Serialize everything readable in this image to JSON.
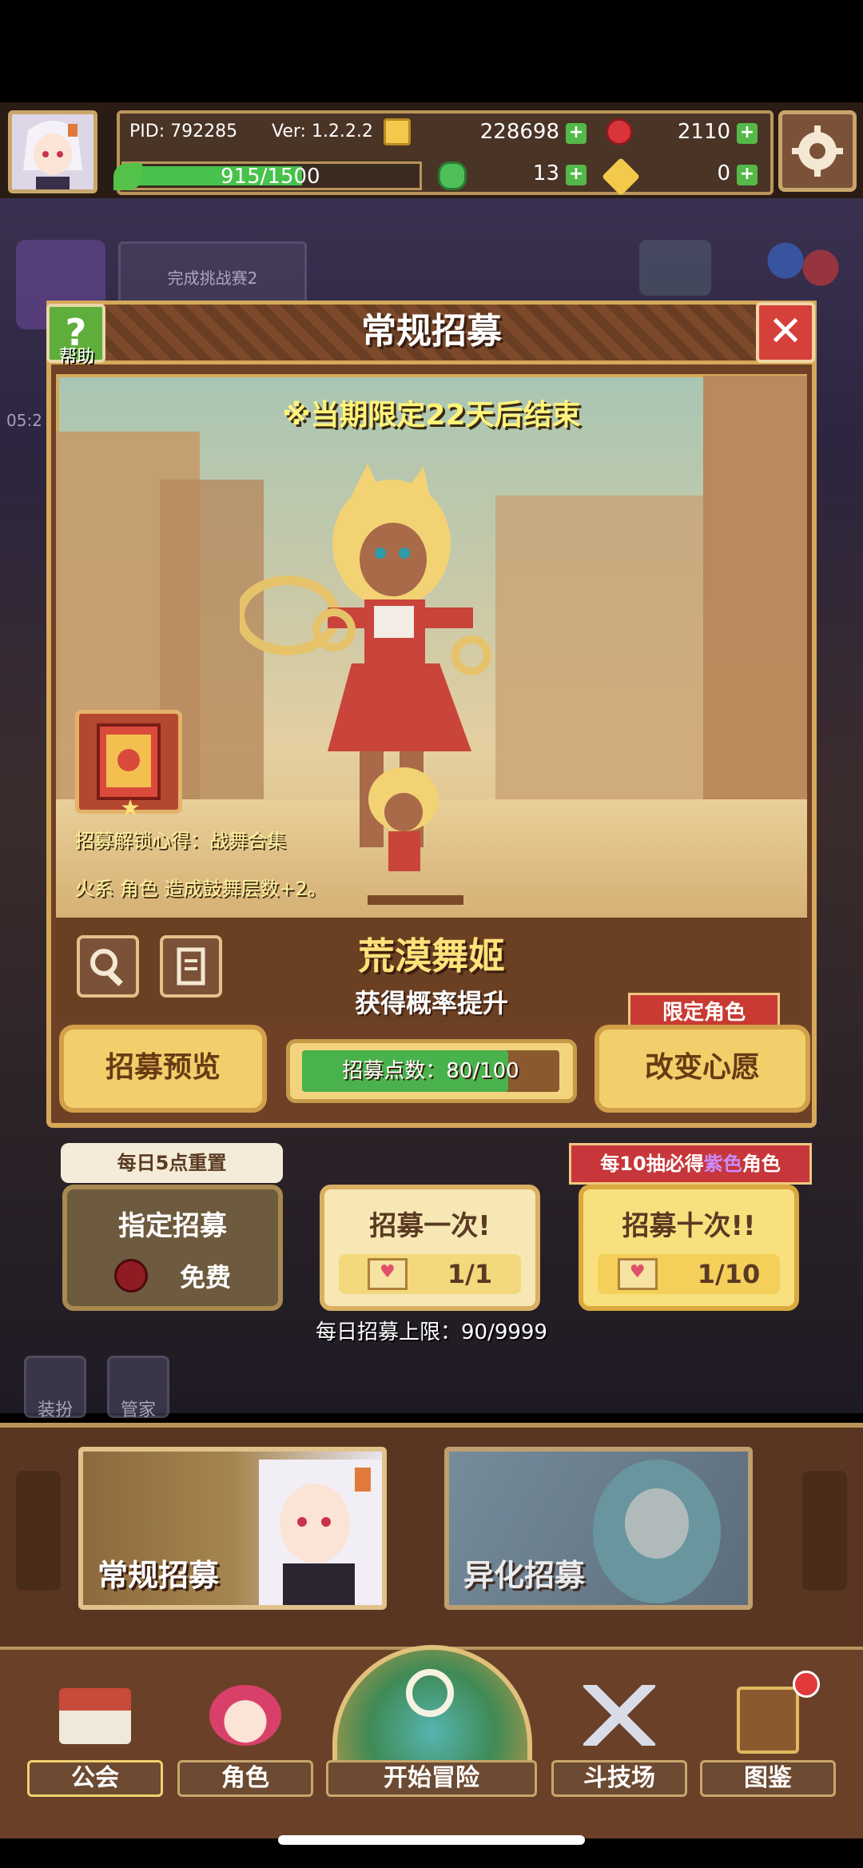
{
  "hud": {
    "pid": "PID: 792285",
    "version": "Ver: 1.2.2.2",
    "gold": "228698",
    "gems": "2110",
    "xp": "915/1500",
    "clover": "13",
    "keys": "0"
  },
  "background": {
    "challenge_tab": "完成挑战赛2",
    "timer": "05:2",
    "left_buttons": [
      "装扮",
      "管家"
    ]
  },
  "modal": {
    "title": "常规招募",
    "help_label": "帮助",
    "limited_notice": "※当期限定22天后结束",
    "unlock_note": "招募解锁心得：战舞合集",
    "effect_note": "火系 角色 造成鼓舞层数+2。",
    "character_name": "荒漠舞姬",
    "character_sub": "获得概率提升",
    "limited_tag": "限定角色",
    "preview_button": "招募预览",
    "change_button": "改变心愿",
    "points_label": "招募点数：80/100",
    "points_fraction": 0.8
  },
  "draws": {
    "reset_tag": "每日5点重置",
    "every10_prefix": "每10抽必得",
    "every10_highlight": "紫色",
    "every10_suffix": "角色",
    "designate": {
      "label": "指定招募",
      "cost": "免费"
    },
    "one": {
      "label": "招募一次!",
      "cost": "1/1"
    },
    "ten": {
      "label": "招募十次!!",
      "cost": "1/10"
    },
    "daily_limit": "每日招募上限：90/9999"
  },
  "tabs": [
    {
      "label": "常规招募"
    },
    {
      "label": "异化招募"
    }
  ],
  "nav": [
    {
      "label": "公会"
    },
    {
      "label": "角色"
    },
    {
      "label": "开始冒险"
    },
    {
      "label": "斗技场"
    },
    {
      "label": "图鉴"
    }
  ],
  "colors": {
    "accent_gold": "#d6a95a",
    "title_yellow": "#fff37a",
    "progress_green": "#49b24d",
    "close_red": "#d6403a"
  }
}
